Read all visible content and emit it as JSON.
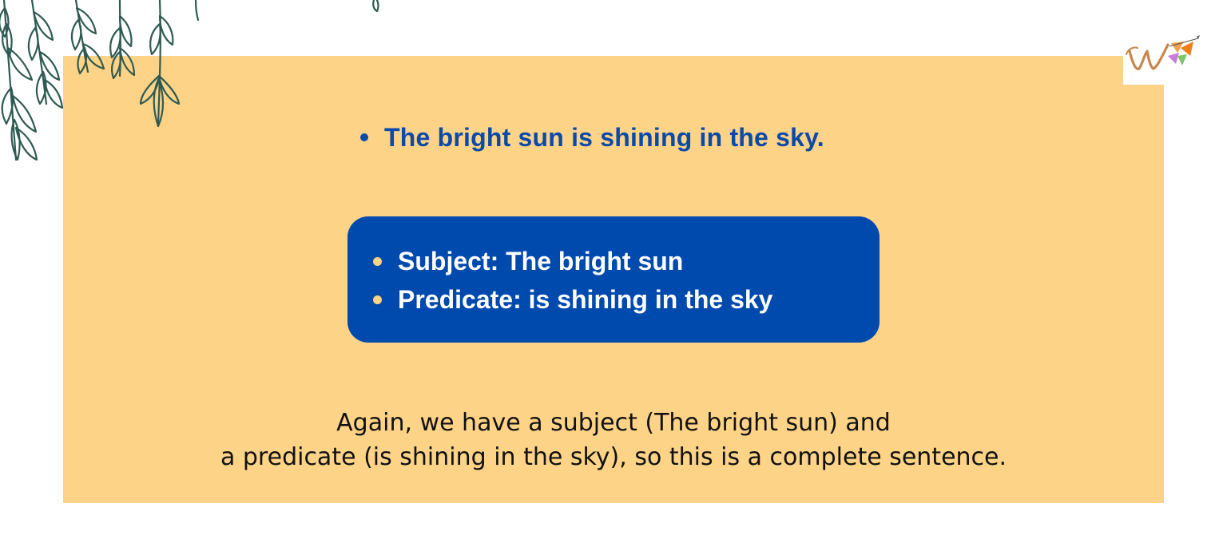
{
  "headline": {
    "sentence": "The bright sun is shining in the sky."
  },
  "analysis_box": {
    "items": [
      {
        "label": "Subject: The bright sun"
      },
      {
        "label": "Predicate: is shining in the sky"
      }
    ]
  },
  "explanation": {
    "line1": "Again, we have a subject (The bright sun) and",
    "line2": "a predicate (is shining in the sky), so this is a complete sentence."
  },
  "colors": {
    "panel": "#fdd387",
    "accent_blue": "#0049ad",
    "headline_blue": "#0b4aa8",
    "leaf_stroke": "#2f5a52"
  },
  "icons": {
    "decoration": "hanging-leaves-icon",
    "logo": "w-brand-logo-icon"
  }
}
